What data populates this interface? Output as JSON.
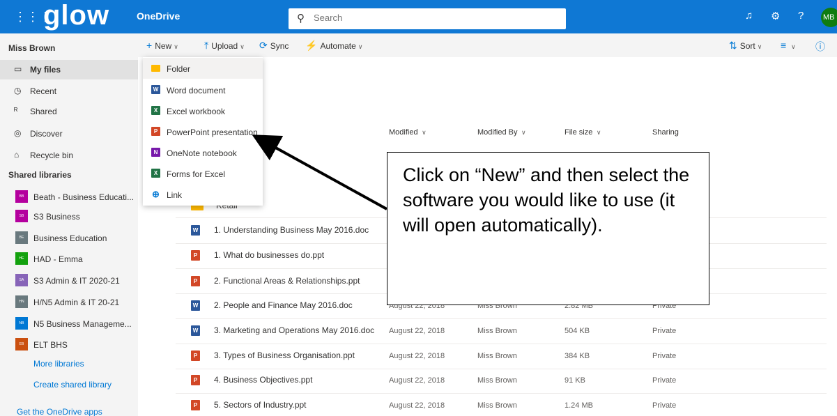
{
  "topbar": {
    "brand": "glow",
    "app_name": "OneDrive",
    "search_placeholder": "Search",
    "avatar_initials": "MB",
    "help_glyph": "?",
    "color": "#0f78d4"
  },
  "sidebar": {
    "user_name": "Miss Brown",
    "nav": [
      {
        "label": "My files",
        "icon": "folder-icon",
        "active": true
      },
      {
        "label": "Recent",
        "icon": "clock-icon"
      },
      {
        "label": "Shared",
        "icon": "people-icon"
      },
      {
        "label": "Discover",
        "icon": "compass-icon"
      },
      {
        "label": "Recycle bin",
        "icon": "trash-icon"
      }
    ],
    "shared_libraries_heading": "Shared libraries",
    "libraries": [
      {
        "label": "Beath - Business Educati...",
        "color": "#b4009e",
        "badge": "BB"
      },
      {
        "label": "S3 Business",
        "color": "#b4009e",
        "badge": "SB"
      },
      {
        "label": "Business Education",
        "color": "#69797e",
        "badge": "BE"
      },
      {
        "label": "HAD - Emma",
        "color": "#13a10e",
        "badge": "HE"
      },
      {
        "label": "S3 Admin & IT 2020-21",
        "color": "#8764b8",
        "badge": "SA"
      },
      {
        "label": "H/N5 Admin & IT 20-21",
        "color": "#69797e",
        "badge": "HN"
      },
      {
        "label": "N5 Business Manageme...",
        "color": "#0078d4",
        "badge": "NB"
      },
      {
        "label": "ELT BHS",
        "color": "#ca5010",
        "badge": "EB"
      }
    ],
    "more_libraries": "More libraries",
    "create_shared_library": "Create shared library",
    "get_apps": "Get the OneDrive apps"
  },
  "commandbar": {
    "new": "New",
    "upload": "Upload",
    "sync": "Sync",
    "automate": "Automate",
    "sort": "Sort"
  },
  "new_menu": [
    {
      "label": "Folder",
      "icon": "folder-icon",
      "color": "#ffb900",
      "glyph": ""
    },
    {
      "label": "Word document",
      "icon": "word-icon",
      "color": "#2b579a",
      "glyph": "W"
    },
    {
      "label": "Excel workbook",
      "icon": "excel-icon",
      "color": "#217346",
      "glyph": "X"
    },
    {
      "label": "PowerPoint presentation",
      "icon": "powerpoint-icon",
      "color": "#d24726",
      "glyph": "P"
    },
    {
      "label": "OneNote notebook",
      "icon": "onenote-icon",
      "color": "#7719aa",
      "glyph": "N"
    },
    {
      "label": "Forms for Excel",
      "icon": "forms-icon",
      "color": "#217346",
      "glyph": "X"
    },
    {
      "label": "Link",
      "icon": "globe-icon",
      "color": "#0078d4",
      "glyph": "⊕"
    }
  ],
  "columns": {
    "modified": "Modified",
    "modified_by": "Modified By",
    "file_size": "File size",
    "sharing": "Sharing"
  },
  "folder_row": {
    "name": "Retail"
  },
  "files": [
    {
      "name": "1. Understanding Business May 2016.doc",
      "type": "word",
      "modified": "",
      "by": "",
      "size": "",
      "sharing": ""
    },
    {
      "name": "1. What do businesses do.ppt",
      "type": "ppt",
      "modified": "",
      "by": "",
      "size": "",
      "sharing": ""
    },
    {
      "name": "2. Functional Areas & Relationships.ppt",
      "type": "ppt",
      "modified": "",
      "by": "",
      "size": "",
      "sharing": ""
    },
    {
      "name": "2. People and Finance May 2016.doc",
      "type": "word",
      "modified": "August 22, 2018",
      "by": "Miss Brown",
      "size": "2.82 MB",
      "sharing": "Private"
    },
    {
      "name": "3. Marketing and Operations May 2016.doc",
      "type": "word",
      "modified": "August 22, 2018",
      "by": "Miss Brown",
      "size": "504 KB",
      "sharing": "Private"
    },
    {
      "name": "3. Types of Business Organisation.ppt",
      "type": "ppt",
      "modified": "August 22, 2018",
      "by": "Miss Brown",
      "size": "384 KB",
      "sharing": "Private"
    },
    {
      "name": "4. Business Objectives.ppt",
      "type": "ppt",
      "modified": "August 22, 2018",
      "by": "Miss Brown",
      "size": "91 KB",
      "sharing": "Private"
    },
    {
      "name": "5. Sectors of Industry.ppt",
      "type": "ppt",
      "modified": "August 22, 2018",
      "by": "Miss Brown",
      "size": "1.24 MB",
      "sharing": "Private"
    }
  ],
  "callout": {
    "text": "Click on “New” and then select the software you would like to use (it will open automatically)."
  }
}
